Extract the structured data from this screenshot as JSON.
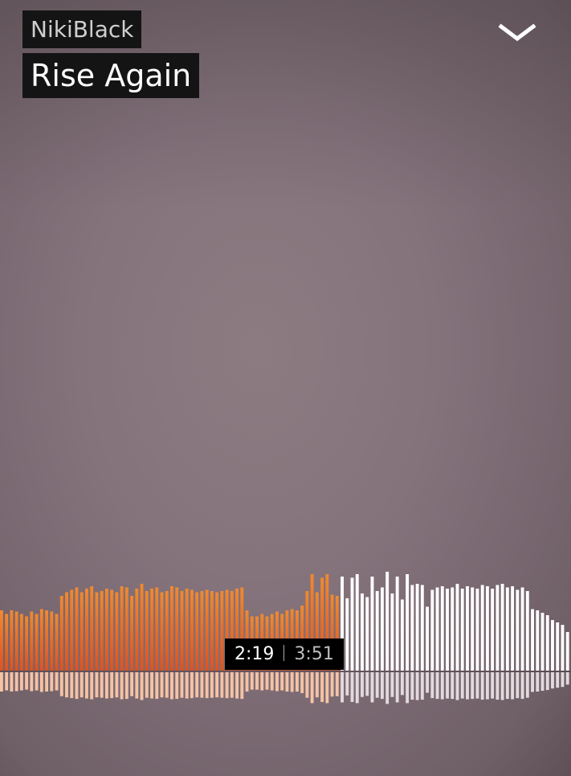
{
  "track": {
    "artist": "NikiBlack",
    "title": "Rise Again"
  },
  "header": {
    "collapse_icon": "chevron-down-icon"
  },
  "player": {
    "elapsed": "2:19",
    "duration": "3:51",
    "progress_fraction": 0.6017
  },
  "waveform": {
    "played_color_top": "#e0521e",
    "played_color_bottom": "#f08a30",
    "played_reflection_color": "#f4c3a6",
    "unplayed_color": "#ffffff",
    "unplayed_reflection_color": "#e2dadd",
    "amplitudes": [
      0.5,
      0.47,
      0.5,
      0.49,
      0.47,
      0.45,
      0.49,
      0.47,
      0.51,
      0.5,
      0.49,
      0.47,
      0.62,
      0.65,
      0.67,
      0.69,
      0.65,
      0.68,
      0.7,
      0.65,
      0.66,
      0.68,
      0.67,
      0.65,
      0.7,
      0.69,
      0.62,
      0.68,
      0.72,
      0.66,
      0.68,
      0.69,
      0.65,
      0.66,
      0.7,
      0.69,
      0.66,
      0.68,
      0.67,
      0.65,
      0.66,
      0.67,
      0.66,
      0.65,
      0.66,
      0.67,
      0.66,
      0.68,
      0.69,
      0.5,
      0.45,
      0.45,
      0.47,
      0.45,
      0.47,
      0.49,
      0.47,
      0.5,
      0.51,
      0.5,
      0.54,
      0.66,
      0.8,
      0.65,
      0.77,
      0.8,
      0.63,
      0.62,
      0.78,
      0.6,
      0.77,
      0.8,
      0.64,
      0.61,
      0.78,
      0.66,
      0.69,
      0.82,
      0.64,
      0.78,
      0.59,
      0.8,
      0.71,
      0.72,
      0.71,
      0.53,
      0.67,
      0.69,
      0.7,
      0.68,
      0.69,
      0.72,
      0.68,
      0.7,
      0.69,
      0.68,
      0.71,
      0.7,
      0.68,
      0.71,
      0.72,
      0.69,
      0.7,
      0.67,
      0.69,
      0.66,
      0.51,
      0.5,
      0.48,
      0.46,
      0.42,
      0.4,
      0.38,
      0.32
    ]
  }
}
